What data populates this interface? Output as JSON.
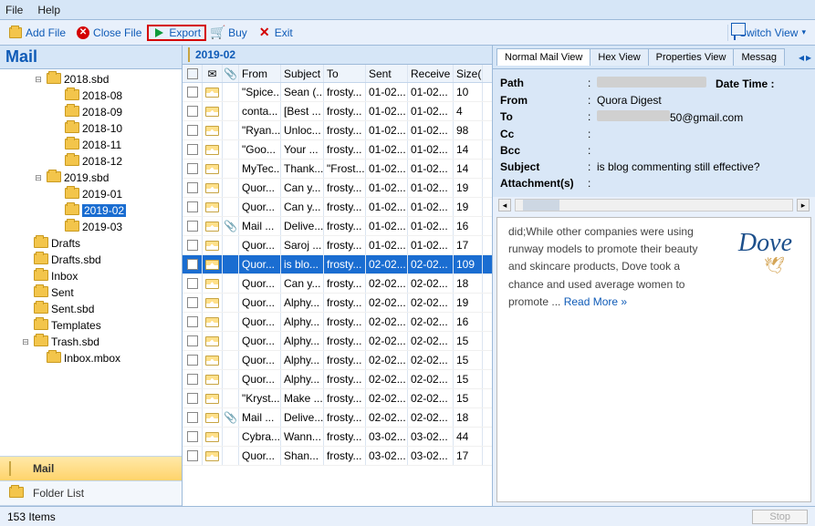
{
  "menu": {
    "file": "File",
    "help": "Help"
  },
  "toolbar": {
    "add": "Add File",
    "close": "Close File",
    "export": "Export",
    "buy": "Buy",
    "exit": "Exit",
    "switch": "Switch View"
  },
  "left": {
    "title": "Mail",
    "tree": [
      {
        "lvl": 2,
        "exp": "-",
        "label": "2018.sbd"
      },
      {
        "lvl": 3,
        "exp": "",
        "label": "2018-08"
      },
      {
        "lvl": 3,
        "exp": "",
        "label": "2018-09"
      },
      {
        "lvl": 3,
        "exp": "",
        "label": "2018-10"
      },
      {
        "lvl": 3,
        "exp": "",
        "label": "2018-11"
      },
      {
        "lvl": 3,
        "exp": "",
        "label": "2018-12"
      },
      {
        "lvl": 2,
        "exp": "-",
        "label": "2019.sbd"
      },
      {
        "lvl": 3,
        "exp": "",
        "label": "2019-01"
      },
      {
        "lvl": 3,
        "exp": "",
        "label": "2019-02",
        "sel": true
      },
      {
        "lvl": 3,
        "exp": "",
        "label": "2019-03"
      },
      {
        "lvl": 1,
        "exp": "",
        "label": "Drafts"
      },
      {
        "lvl": 1,
        "exp": "",
        "label": "Drafts.sbd"
      },
      {
        "lvl": 1,
        "exp": "",
        "label": "Inbox"
      },
      {
        "lvl": 1,
        "exp": "",
        "label": "Sent"
      },
      {
        "lvl": 1,
        "exp": "",
        "label": "Sent.sbd"
      },
      {
        "lvl": 1,
        "exp": "",
        "label": "Templates"
      },
      {
        "lvl": 1,
        "exp": "-",
        "label": "Trash.sbd"
      },
      {
        "lvl": 2,
        "exp": "",
        "label": "Inbox.mbox"
      }
    ],
    "nav": {
      "mail": "Mail",
      "folder": "Folder List"
    }
  },
  "list": {
    "title": "2019-02",
    "cols": {
      "from": "From",
      "subject": "Subject",
      "to": "To",
      "sent": "Sent",
      "receive": "Receive",
      "size": "Size("
    },
    "rows": [
      {
        "from": "\"Spice...",
        "subj": "Sean (...",
        "to": "frosty...",
        "sent": "01-02...",
        "recv": "01-02...",
        "size": "10",
        "att": false
      },
      {
        "from": "conta...",
        "subj": "[Best ...",
        "to": "frosty...",
        "sent": "01-02...",
        "recv": "01-02...",
        "size": "4",
        "att": false
      },
      {
        "from": "\"Ryan...",
        "subj": "Unloc...",
        "to": "frosty...",
        "sent": "01-02...",
        "recv": "01-02...",
        "size": "98",
        "att": false
      },
      {
        "from": "\"Goo...",
        "subj": "Your ...",
        "to": "frosty...",
        "sent": "01-02...",
        "recv": "01-02...",
        "size": "14",
        "att": false
      },
      {
        "from": "MyTec...",
        "subj": "Thank...",
        "to": "\"Frost...",
        "sent": "01-02...",
        "recv": "01-02...",
        "size": "14",
        "att": false
      },
      {
        "from": "Quor...",
        "subj": "Can y...",
        "to": "frosty...",
        "sent": "01-02...",
        "recv": "01-02...",
        "size": "19",
        "att": false
      },
      {
        "from": "Quor...",
        "subj": "Can y...",
        "to": "frosty...",
        "sent": "01-02...",
        "recv": "01-02...",
        "size": "19",
        "att": false
      },
      {
        "from": "Mail ...",
        "subj": "Delive...",
        "to": "frosty...",
        "sent": "01-02...",
        "recv": "01-02...",
        "size": "16",
        "att": true
      },
      {
        "from": "Quor...",
        "subj": "Saroj ...",
        "to": "frosty...",
        "sent": "01-02...",
        "recv": "01-02...",
        "size": "17",
        "att": false
      },
      {
        "from": "Quor...",
        "subj": "is blo...",
        "to": "frosty...",
        "sent": "02-02...",
        "recv": "02-02...",
        "size": "109",
        "att": false,
        "sel": true
      },
      {
        "from": "Quor...",
        "subj": "Can y...",
        "to": "frosty...",
        "sent": "02-02...",
        "recv": "02-02...",
        "size": "18",
        "att": false
      },
      {
        "from": "Quor...",
        "subj": "Alphy...",
        "to": "frosty...",
        "sent": "02-02...",
        "recv": "02-02...",
        "size": "19",
        "att": false
      },
      {
        "from": "Quor...",
        "subj": "Alphy...",
        "to": "frosty...",
        "sent": "02-02...",
        "recv": "02-02...",
        "size": "16",
        "att": false
      },
      {
        "from": "Quor...",
        "subj": "Alphy...",
        "to": "frosty...",
        "sent": "02-02...",
        "recv": "02-02...",
        "size": "15",
        "att": false
      },
      {
        "from": "Quor...",
        "subj": "Alphy...",
        "to": "frosty...",
        "sent": "02-02...",
        "recv": "02-02...",
        "size": "15",
        "att": false
      },
      {
        "from": "Quor...",
        "subj": "Alphy...",
        "to": "frosty...",
        "sent": "02-02...",
        "recv": "02-02...",
        "size": "15",
        "att": false
      },
      {
        "from": "\"Kryst...",
        "subj": "Make ...",
        "to": "frosty...",
        "sent": "02-02...",
        "recv": "02-02...",
        "size": "15",
        "att": false
      },
      {
        "from": "Mail ...",
        "subj": "Delive...",
        "to": "frosty...",
        "sent": "02-02...",
        "recv": "02-02...",
        "size": "18",
        "att": true
      },
      {
        "from": "Cybra...",
        "subj": "Wann...",
        "to": "frosty...",
        "sent": "03-02...",
        "recv": "03-02...",
        "size": "44",
        "att": false
      },
      {
        "from": "Quor...",
        "subj": "Shan...",
        "to": "frosty...",
        "sent": "03-02...",
        "recv": "03-02...",
        "size": "17",
        "att": false
      }
    ]
  },
  "right": {
    "tabs": {
      "normal": "Normal Mail View",
      "hex": "Hex View",
      "prop": "Properties View",
      "msg": "Messag"
    },
    "hdr": {
      "path_k": "Path",
      "date_k": "Date Time :",
      "from_k": "From",
      "from_v": "Quora Digest",
      "to_k": "To",
      "to_v": "50@gmail.com",
      "cc_k": "Cc",
      "bcc_k": "Bcc",
      "subj_k": "Subject",
      "subj_v": "is blog commenting still effective?",
      "att_k": "Attachment(s)"
    },
    "body": {
      "brand": "Dove",
      "text": "did;While other companies were using runway models to promote their beauty and skincare products, Dove took a chance and used average women to promote ... ",
      "more": "Read More »"
    }
  },
  "status": {
    "count": "153 Items",
    "stop": "Stop"
  }
}
